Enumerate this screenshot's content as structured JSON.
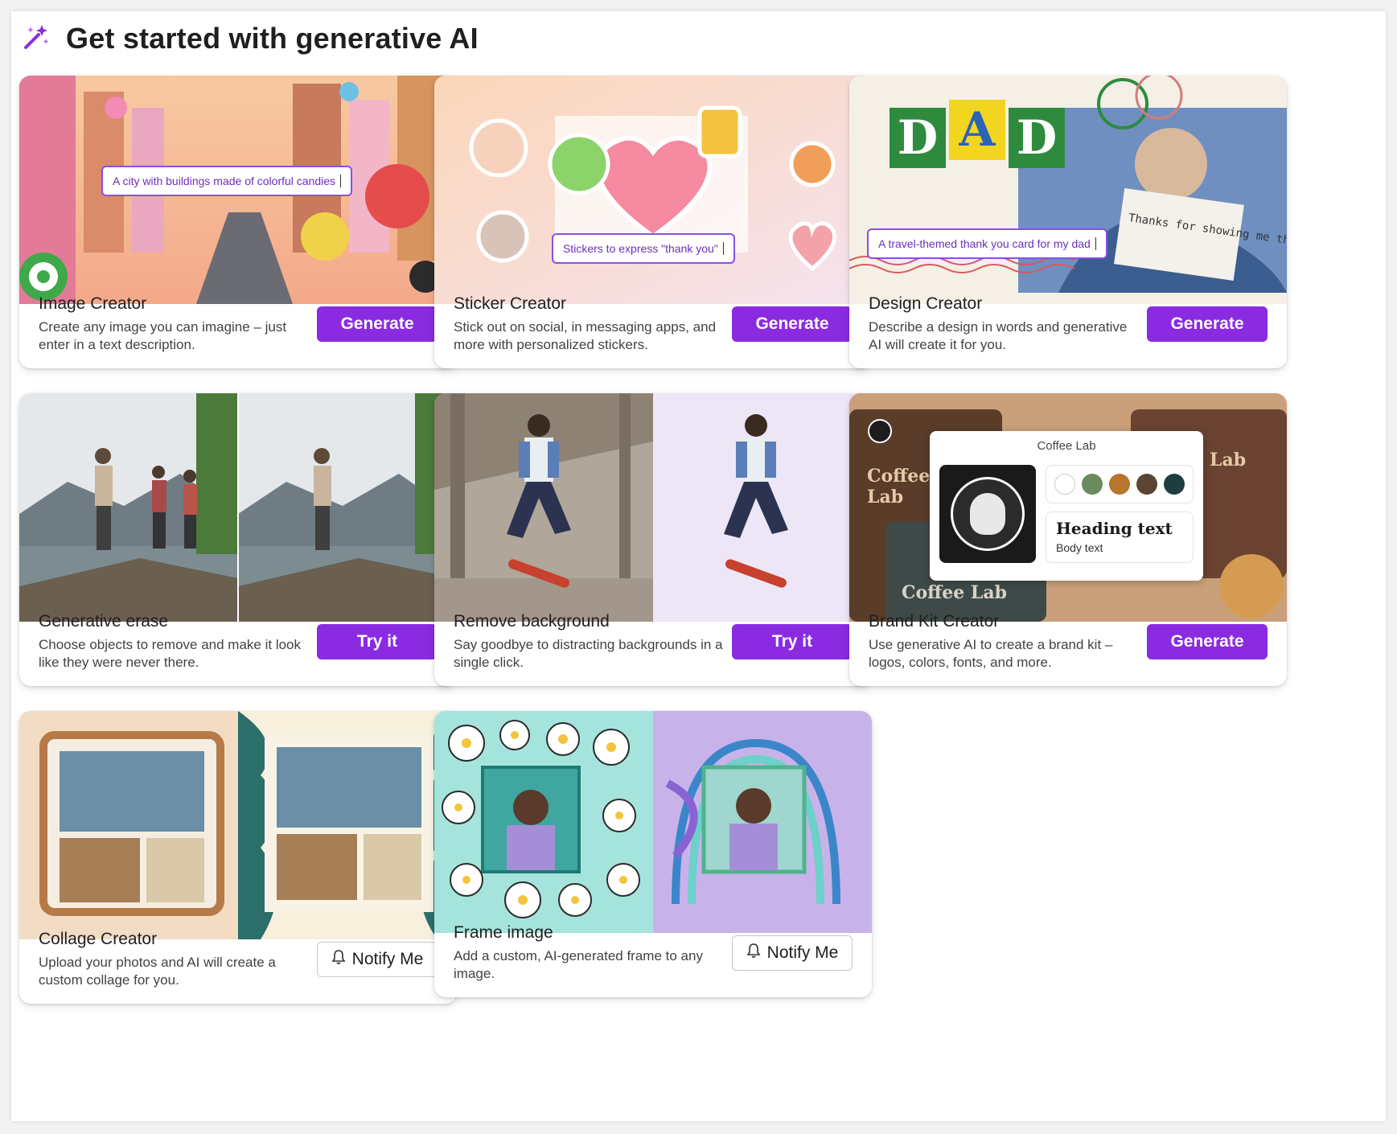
{
  "page": {
    "title": "Get started with generative AI",
    "accent": "#8a2be2"
  },
  "cards": [
    {
      "title": "Image Creator",
      "desc": "Create any image you can imagine – just enter in a text description.",
      "button": "Generate",
      "prompt": "A city with buildings made of colorful candies",
      "image": "candy-city-image"
    },
    {
      "title": "Sticker Creator",
      "desc": "Stick out on social, in messaging apps, and more with personalized stickers.",
      "button": "Generate",
      "prompt": "Stickers to express \"thank you\"",
      "image": "stickers-image"
    },
    {
      "title": "Design Creator",
      "desc": "Describe a design in words and generative AI will create it for you.",
      "button": "Generate",
      "prompt": "A travel-themed thank you card for my dad",
      "image": "dad-card-image",
      "deco": {
        "dad": "DAD",
        "note": "Thanks for showing me the world."
      }
    },
    {
      "title": "Generative erase",
      "desc": "Choose objects to remove and make it look like they were never there.",
      "button": "Try it",
      "image": "hikers-image"
    },
    {
      "title": "Remove background",
      "desc": "Say goodbye to distracting backgrounds in a single click.",
      "button": "Try it",
      "image": "skater-image"
    },
    {
      "title": "Brand Kit Creator",
      "desc": "Use generative AI to create a brand kit – logos, colors, fonts, and more.",
      "button": "Generate",
      "image": "coffee-brand-image",
      "kit": {
        "name": "Coffee Lab",
        "heading": "Heading text",
        "body": "Body text",
        "colors": [
          "#ffffff",
          "#6b8a5e",
          "#b8752d",
          "#5a4433",
          "#1f3d3d"
        ]
      }
    },
    {
      "title": "Collage Creator",
      "desc": "Upload your photos and AI will create a custom collage for you.",
      "button": "Notify Me",
      "image": "collage-image"
    },
    {
      "title": "Frame image",
      "desc": "Add a custom, AI-generated frame to any image.",
      "button": "Notify Me",
      "image": "frame-image"
    }
  ]
}
